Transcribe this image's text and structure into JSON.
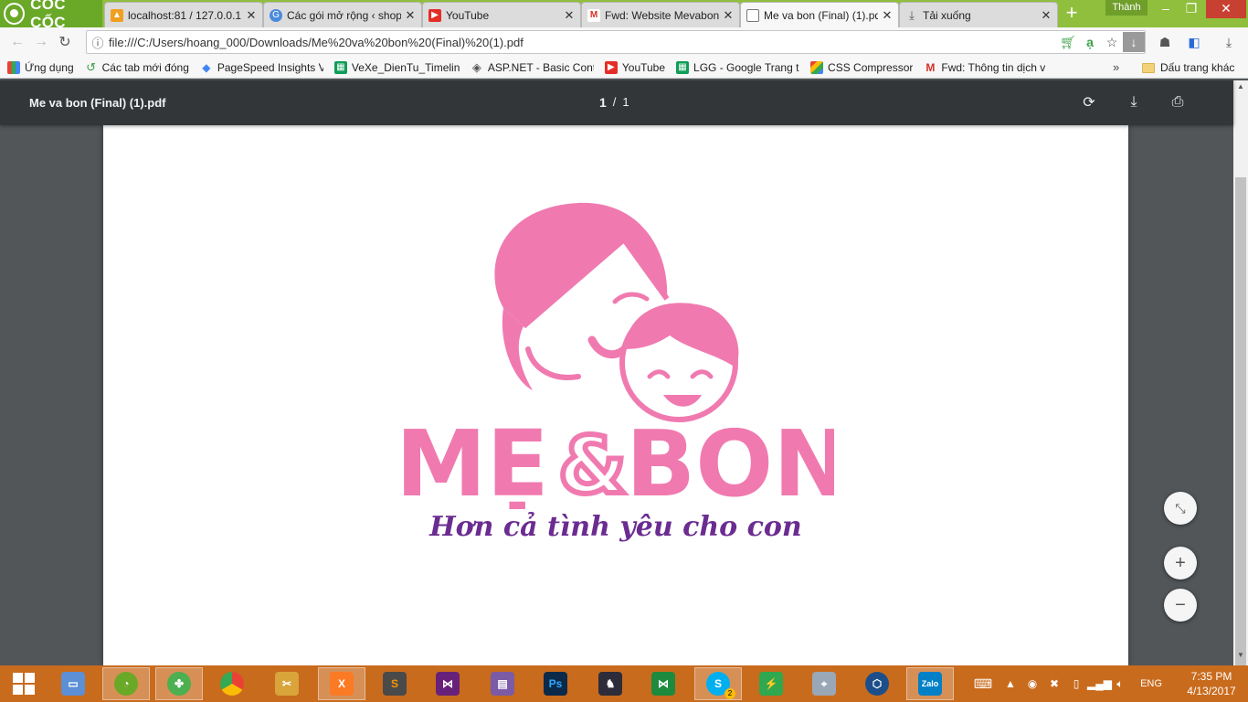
{
  "browser": {
    "brand": "CỐC CỐC",
    "profile_name": "Thành",
    "tabs": [
      {
        "label": "localhost:81 / 127.0.0.1",
        "favicon": "phpmyadmin-icon",
        "active": false
      },
      {
        "label": "Các gói mở rộng ‹ shop",
        "favicon": "wordpress-icon",
        "active": false
      },
      {
        "label": "YouTube",
        "favicon": "youtube-icon",
        "active": false
      },
      {
        "label": "Fwd: Website Mevabon",
        "favicon": "gmail-icon",
        "active": false
      },
      {
        "label": "Me va bon (Final) (1).pdf",
        "favicon": "document-icon",
        "active": true
      },
      {
        "label": "Tải xuống",
        "favicon": "download-icon",
        "active": false
      }
    ],
    "new_tab_label": "+",
    "url": "file:///C:/Users/hoang_000/Downloads/Me%20va%20bon%20(Final)%20(1).pdf",
    "bookmarks": [
      {
        "label": "Ứng dụng",
        "icon": "apps-grid-icon"
      },
      {
        "label": "Các tab mới đóng",
        "icon": "recent-tabs-icon"
      },
      {
        "label": "PageSpeed Insights V",
        "icon": "pagespeed-icon"
      },
      {
        "label": "VeXe_DienTu_Timeline",
        "icon": "sheets-icon"
      },
      {
        "label": "ASP.NET - Basic Contr",
        "icon": "aspnet-icon"
      },
      {
        "label": "YouTube",
        "icon": "youtube-icon"
      },
      {
        "label": "LGG - Google Trang tí",
        "icon": "sheets-icon"
      },
      {
        "label": "CSS Compressor",
        "icon": "css-compressor-icon"
      },
      {
        "label": "Fwd: Thông tin dịch v",
        "icon": "gmail-icon"
      }
    ],
    "bookmarks_more": "»",
    "other_bookmarks": "Dấu trang khác"
  },
  "pdf": {
    "title": "Me va bon (Final) (1).pdf",
    "current_page": "1",
    "page_sep": "/",
    "total_pages": "1",
    "logo_text_left": "MẸ",
    "logo_amp": "&",
    "logo_text_right": "BON",
    "slogan": "Hơn cả tình yêu cho con",
    "brand_pink": "#f07ab0",
    "slogan_purple": "#6b2c91"
  },
  "taskbar": {
    "apps": [
      "coccoc",
      "clover",
      "chrome",
      "tools",
      "xampp",
      "sublime-text",
      "visual-studio",
      "winrar",
      "photoshop",
      "game",
      "visual-studio-code",
      "skype",
      "transfer",
      "network-tool",
      "virtualbox",
      "zalo"
    ],
    "photoshop_label": "Ps",
    "zalo_label": "Zalo",
    "skype_badge": "2",
    "language": "ENG",
    "time": "7:35 PM",
    "date": "4/13/2017"
  }
}
